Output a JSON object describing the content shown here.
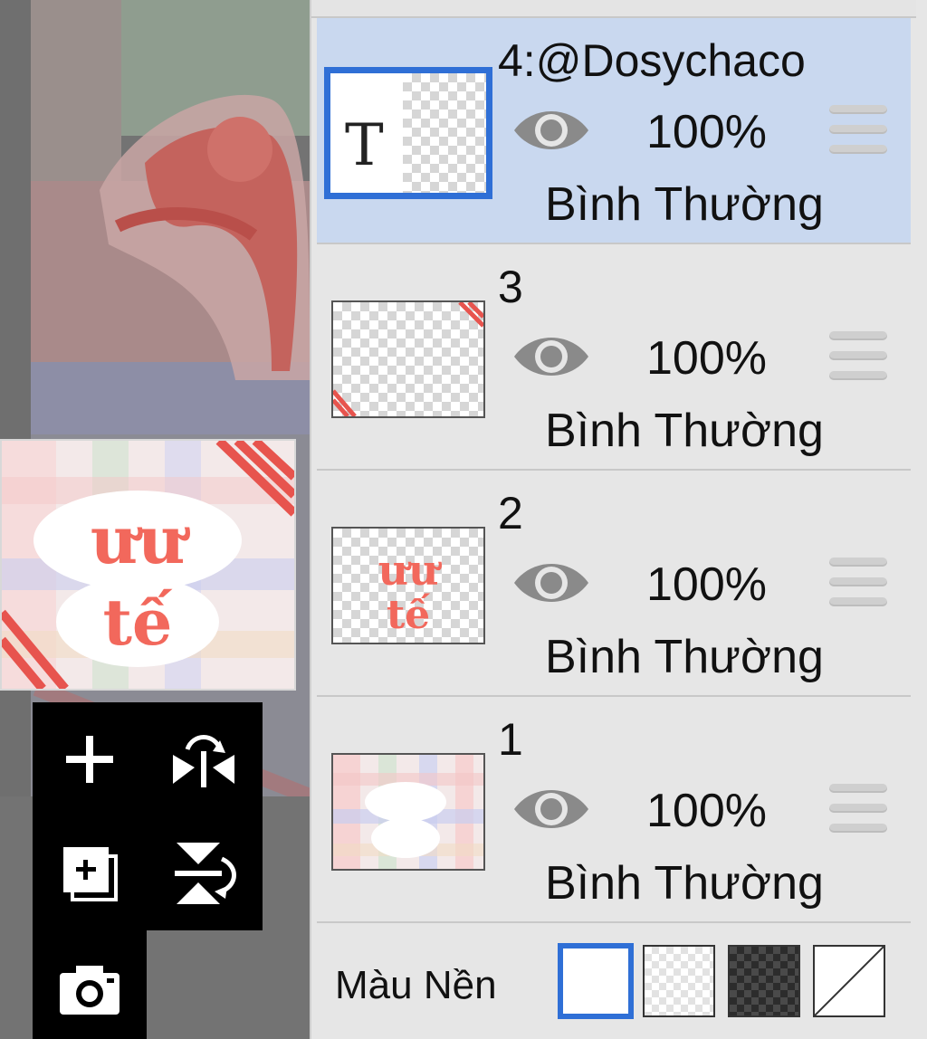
{
  "layers": [
    {
      "name": "4:@Dosychaco",
      "opacity": "100%",
      "blend": "Bình Thường",
      "thumb_glyph": "T",
      "selected": true
    },
    {
      "name": "3",
      "opacity": "100%",
      "blend": "Bình Thường",
      "selected": false
    },
    {
      "name": "2",
      "opacity": "100%",
      "blend": "Bình Thường",
      "selected": false
    },
    {
      "name": "1",
      "opacity": "100%",
      "blend": "Bình Thường",
      "selected": false
    }
  ],
  "background": {
    "label": "Màu Nền",
    "options": [
      "white",
      "transparent-light",
      "transparent-dark",
      "none"
    ],
    "selected": "white"
  },
  "colors": {
    "accent": "#2f6fd6",
    "selected_row": "#c9d8ef",
    "panel": "#e6e6e6",
    "artwork_red": "#f2685c"
  },
  "tools": [
    "add-layer-icon",
    "flip-horizontal-icon",
    "duplicate-layer-icon",
    "flip-vertical-icon",
    "camera-icon"
  ]
}
